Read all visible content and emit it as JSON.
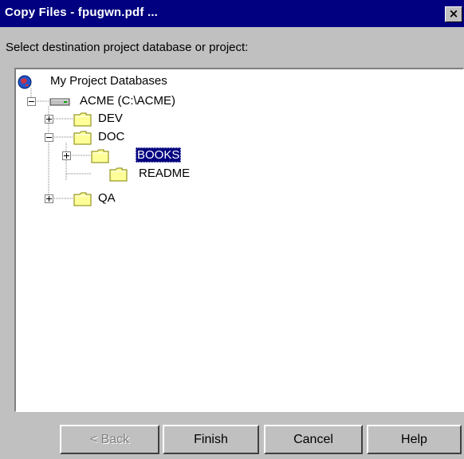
{
  "window": {
    "title": "Copy Files - fpugwn.pdf ...",
    "close_glyph": "×"
  },
  "prompt": "Select destination project database or project:",
  "tree": {
    "root": {
      "label": "My Project Databases",
      "icon": "globe-icon"
    },
    "database": {
      "label": "ACME (C:\\ACME)",
      "icon": "drive-icon",
      "expanded": true
    },
    "projects": [
      {
        "label": "DEV",
        "icon": "folder-icon",
        "expander": "+"
      },
      {
        "label": "DOC",
        "icon": "folder-icon",
        "expander": "-"
      },
      {
        "label": "BOOKS",
        "icon": "folder-icon",
        "expander": "+",
        "selected": true
      },
      {
        "label": "README",
        "icon": "folder-icon",
        "expander": ""
      },
      {
        "label": "QA",
        "icon": "folder-icon",
        "expander": "+"
      }
    ]
  },
  "buttons": {
    "back": {
      "label": "< Back",
      "enabled": false
    },
    "finish": {
      "label": "Finish",
      "enabled": true
    },
    "cancel": {
      "label": "Cancel",
      "enabled": true
    },
    "help": {
      "label": "Help",
      "enabled": true
    }
  },
  "colors": {
    "titlebar": "#000080",
    "selection": "#000080",
    "face": "#c0c0c0",
    "folder": "#ffff99"
  }
}
